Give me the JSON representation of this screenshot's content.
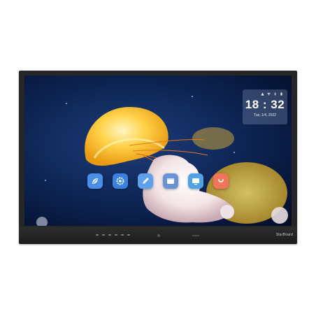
{
  "clock": {
    "time": "18 : 32",
    "date": "Tue, 1/4, 2022",
    "status_icons": [
      "network-icon",
      "wifi-icon",
      "bluetooth-icon",
      "battery-icon"
    ]
  },
  "dock": {
    "apps": [
      {
        "icon": "whiteboard-icon",
        "color": "#4a8fe7"
      },
      {
        "icon": "settings-icon",
        "color": "#3b82e0"
      },
      {
        "icon": "annotate-icon",
        "color": "#5fa0ec"
      },
      {
        "icon": "files-icon",
        "color": "#6a93d6"
      },
      {
        "icon": "screen-share-icon",
        "color": "#4fa2e6"
      },
      {
        "icon": "apps-icon",
        "color": "#f0735a"
      }
    ]
  },
  "device": {
    "brand": "StarBoard"
  }
}
